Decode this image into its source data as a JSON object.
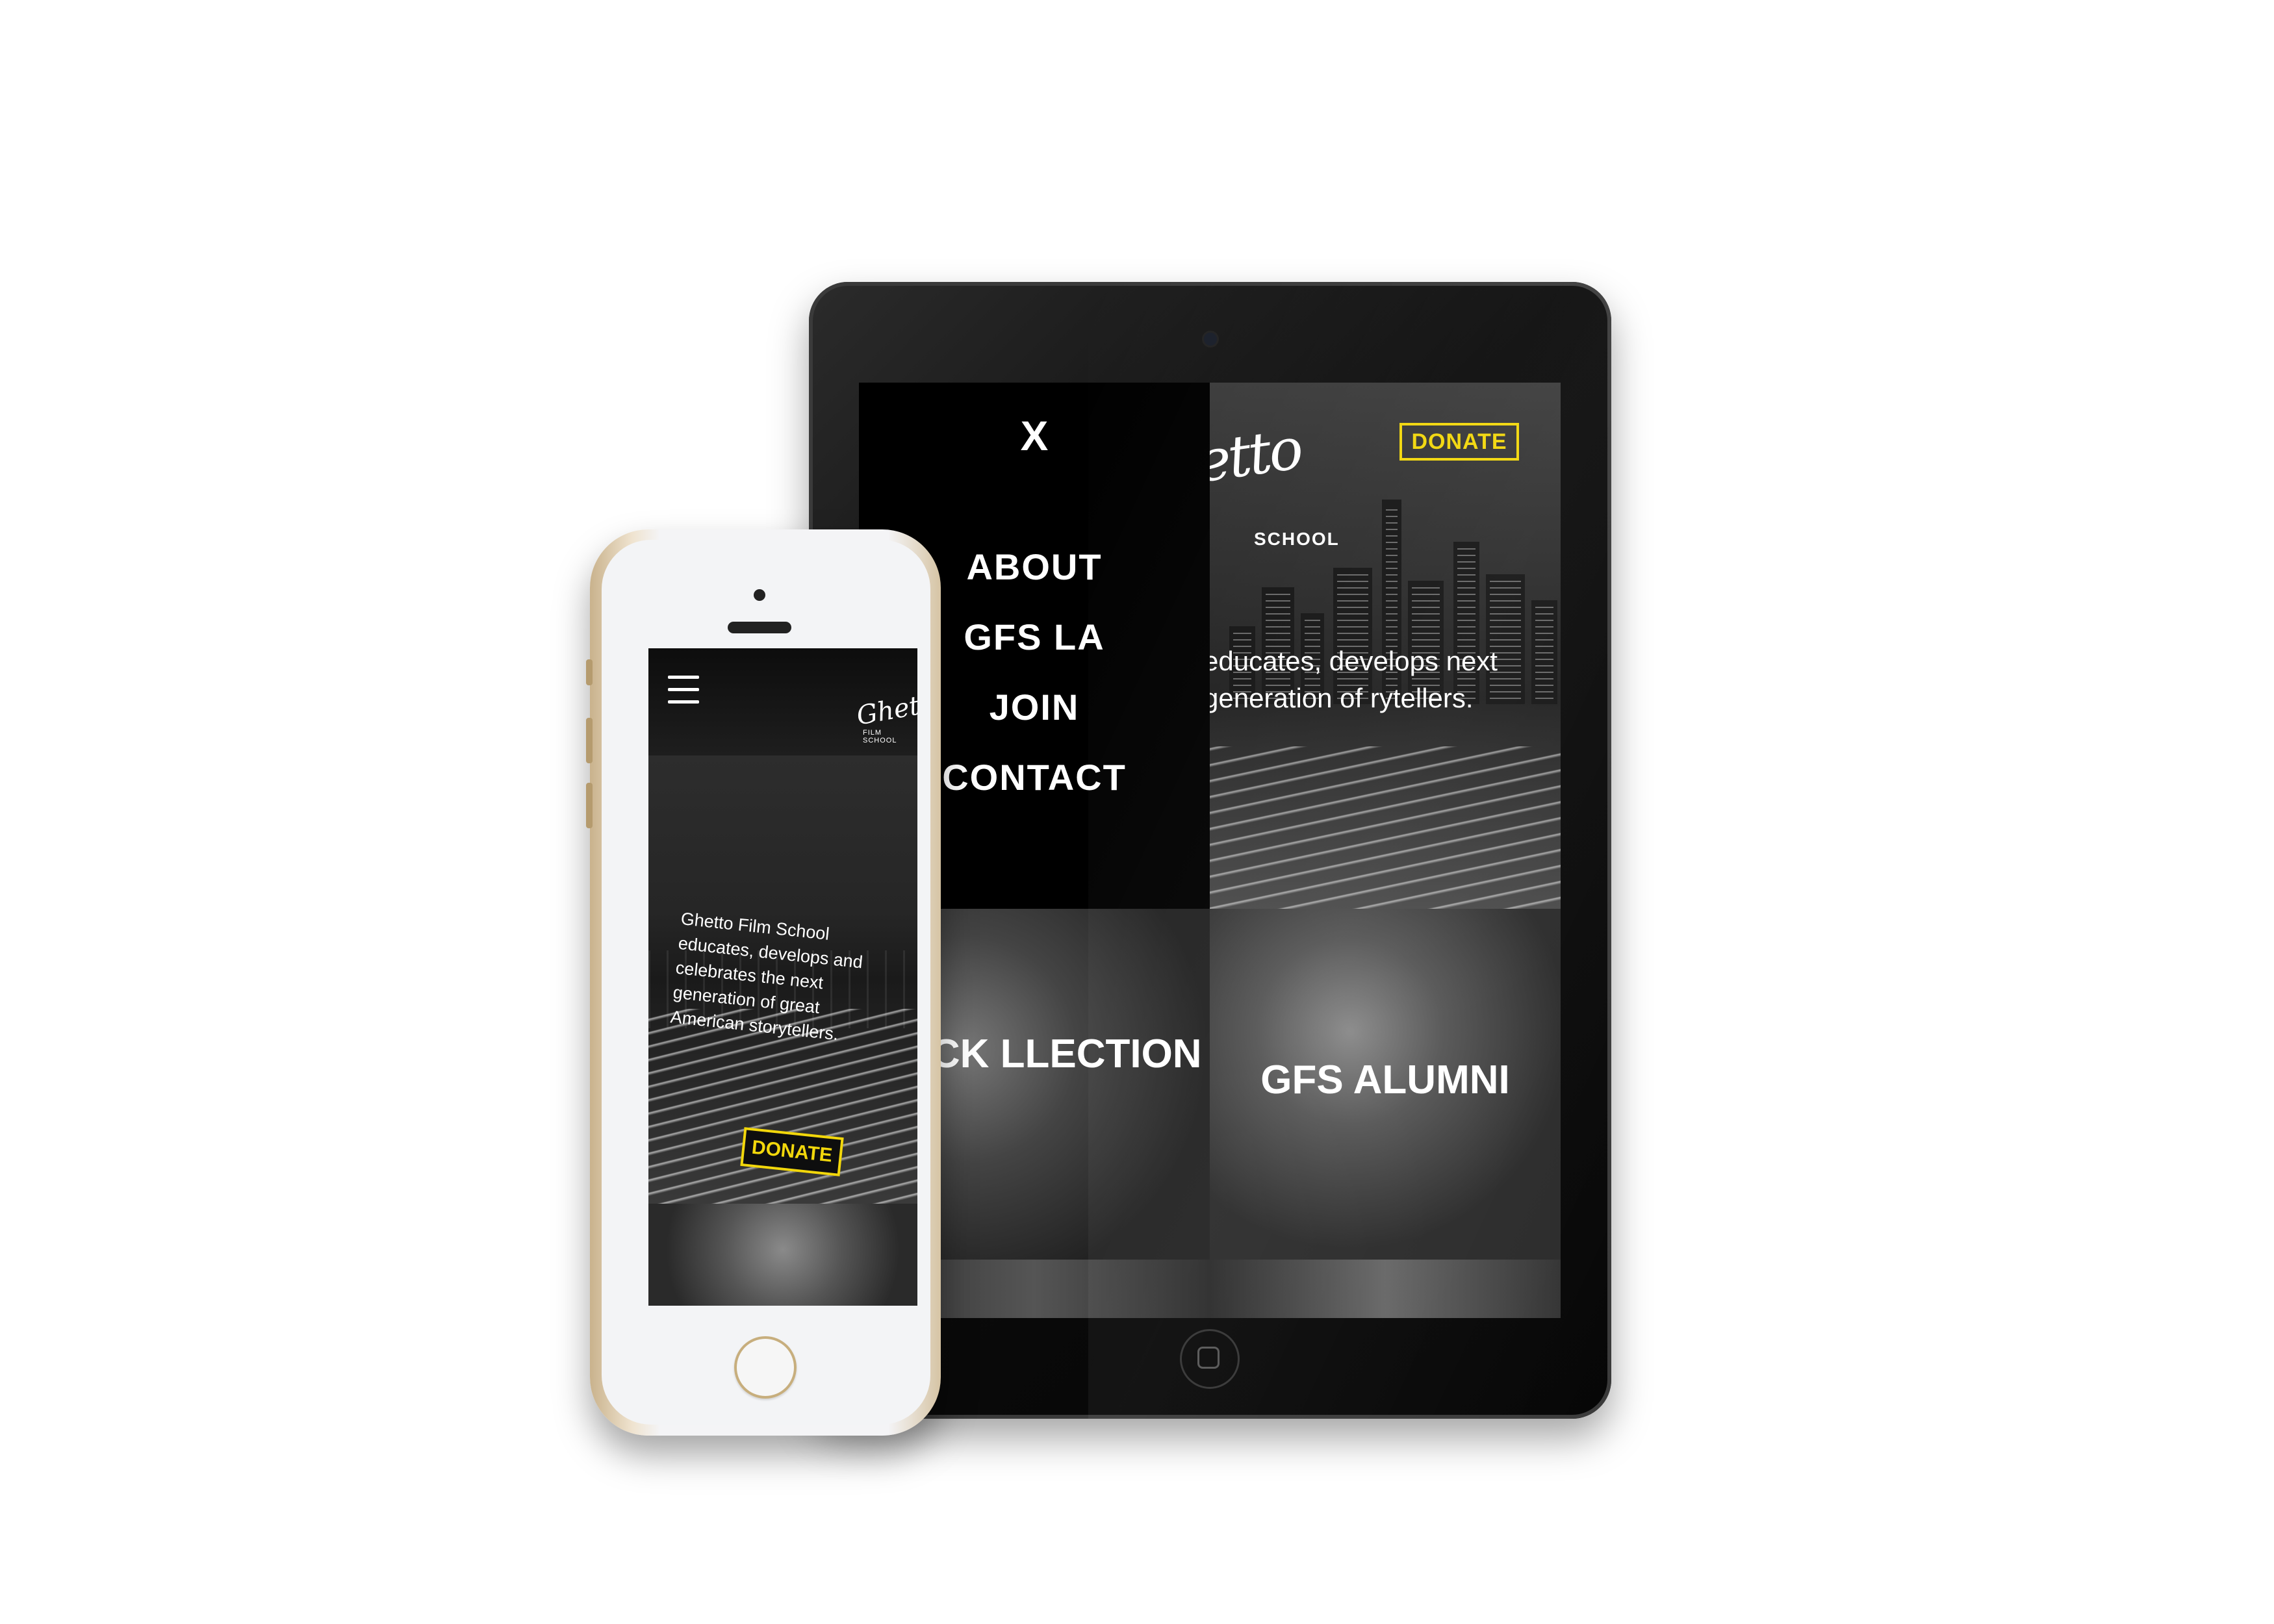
{
  "tablet": {
    "menu": {
      "close_label": "X",
      "items": [
        "ABOUT",
        "GFS LA",
        "JOIN",
        "CONTACT"
      ]
    },
    "hero": {
      "logo_text": "etto",
      "logo_subtext": "SCHOOL",
      "donate_label": "DONATE",
      "tagline": "educates, develops next generation of rytellers."
    },
    "tiles": [
      {
        "label": "E FRICK LLECTION"
      },
      {
        "label": "GFS ALUMNI"
      }
    ]
  },
  "phone": {
    "header": {
      "logo_text": "Ghetto",
      "logo_subtext": "FILM SCHOOL"
    },
    "hero": {
      "tagline": "Ghetto Film School educates, develops and celebrates the next generation of great American storytellers.",
      "donate_label": "DONATE"
    }
  },
  "colors": {
    "accent_yellow": "#f2d70b",
    "menu_background": "#000000",
    "text": "#ffffff",
    "phone_gold": "#c9b28c"
  },
  "icons": {
    "menu": "hamburger-icon",
    "close": "close-icon"
  }
}
